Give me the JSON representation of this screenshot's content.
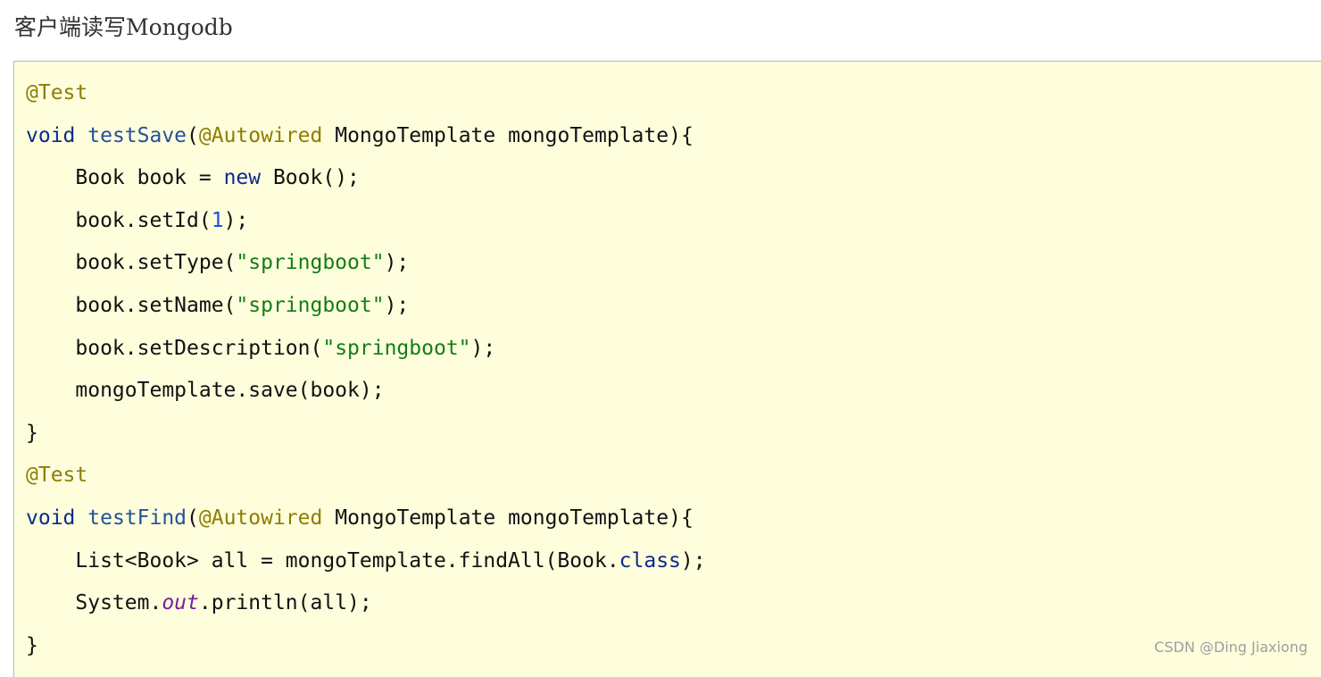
{
  "heading": "客户端读写Mongodb",
  "code": {
    "language": "java",
    "lines": [
      {
        "indent": "",
        "tokens": [
          {
            "text": "@Test",
            "kind": "annot"
          }
        ]
      },
      {
        "indent": "",
        "tokens": [
          {
            "text": "void",
            "kind": "keyword"
          },
          {
            "text": " ",
            "kind": "plain"
          },
          {
            "text": "testSave",
            "kind": "method"
          },
          {
            "text": "(",
            "kind": "plain"
          },
          {
            "text": "@Autowired",
            "kind": "annot"
          },
          {
            "text": " MongoTemplate mongoTemplate){",
            "kind": "plain"
          }
        ]
      },
      {
        "indent": "    ",
        "tokens": [
          {
            "text": "Book book = ",
            "kind": "plain"
          },
          {
            "text": "new",
            "kind": "keyword"
          },
          {
            "text": " Book();",
            "kind": "plain"
          }
        ]
      },
      {
        "indent": "    ",
        "tokens": [
          {
            "text": "book.setId(",
            "kind": "plain"
          },
          {
            "text": "1",
            "kind": "number"
          },
          {
            "text": ");",
            "kind": "plain"
          }
        ]
      },
      {
        "indent": "    ",
        "tokens": [
          {
            "text": "book.setType(",
            "kind": "plain"
          },
          {
            "text": "\"springboot\"",
            "kind": "string"
          },
          {
            "text": ");",
            "kind": "plain"
          }
        ]
      },
      {
        "indent": "    ",
        "tokens": [
          {
            "text": "book.setName(",
            "kind": "plain"
          },
          {
            "text": "\"springboot\"",
            "kind": "string"
          },
          {
            "text": ");",
            "kind": "plain"
          }
        ]
      },
      {
        "indent": "    ",
        "tokens": [
          {
            "text": "book.setDescription(",
            "kind": "plain"
          },
          {
            "text": "\"springboot\"",
            "kind": "string"
          },
          {
            "text": ");",
            "kind": "plain"
          }
        ]
      },
      {
        "indent": "    ",
        "tokens": [
          {
            "text": "mongoTemplate.save(book);",
            "kind": "plain"
          }
        ]
      },
      {
        "indent": "",
        "tokens": [
          {
            "text": "}",
            "kind": "plain"
          }
        ]
      },
      {
        "indent": "",
        "tokens": [
          {
            "text": "@Test",
            "kind": "annot"
          }
        ]
      },
      {
        "indent": "",
        "tokens": [
          {
            "text": "void",
            "kind": "keyword"
          },
          {
            "text": " ",
            "kind": "plain"
          },
          {
            "text": "testFind",
            "kind": "method"
          },
          {
            "text": "(",
            "kind": "plain"
          },
          {
            "text": "@Autowired",
            "kind": "annot"
          },
          {
            "text": " MongoTemplate mongoTemplate){",
            "kind": "plain"
          }
        ]
      },
      {
        "indent": "    ",
        "tokens": [
          {
            "text": "List<Book> all = mongoTemplate.findAll(Book.",
            "kind": "plain"
          },
          {
            "text": "class",
            "kind": "keyword"
          },
          {
            "text": ");",
            "kind": "plain"
          }
        ]
      },
      {
        "indent": "    ",
        "tokens": [
          {
            "text": "System.",
            "kind": "plain"
          },
          {
            "text": "out",
            "kind": "field"
          },
          {
            "text": ".println(all);",
            "kind": "plain"
          }
        ]
      },
      {
        "indent": "",
        "tokens": [
          {
            "text": "}",
            "kind": "plain"
          }
        ]
      }
    ]
  },
  "watermark": "CSDN @Ding Jiaxiong",
  "colors": {
    "code_background": "#fefedd",
    "annotation": "#8d7d00",
    "keyword": "#0b2a8e",
    "method": "#22529b",
    "string": "#147d14",
    "number": "#1a4fe0",
    "field": "#7a1a9a"
  }
}
